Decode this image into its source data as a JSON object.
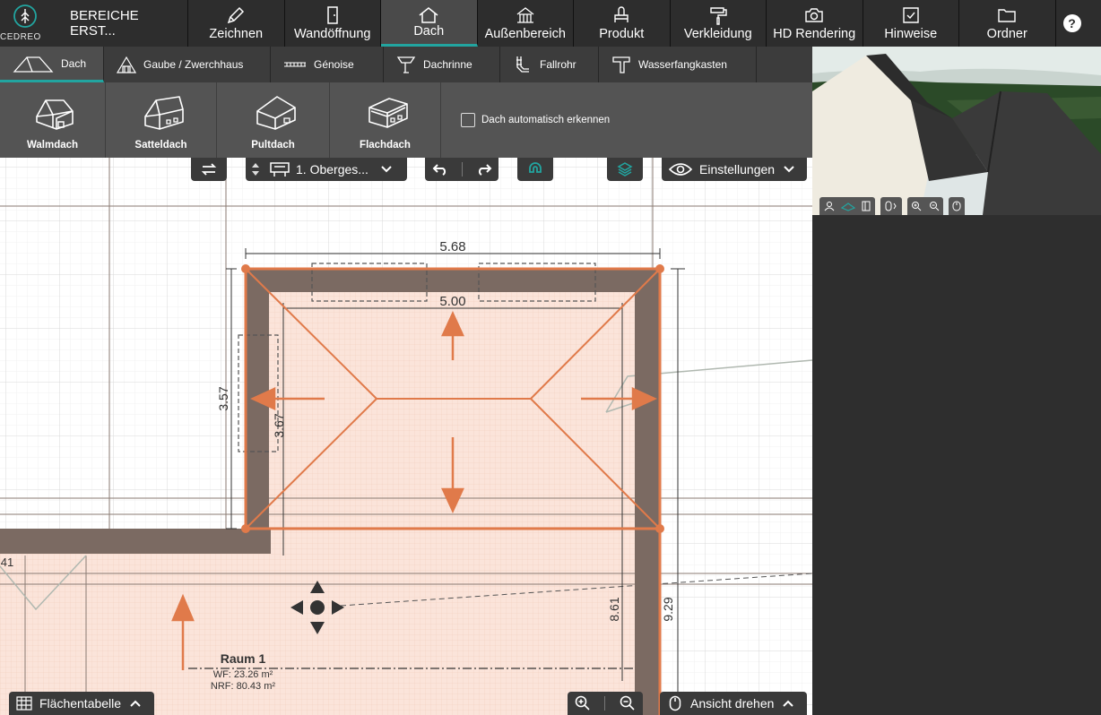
{
  "app": {
    "logo_text": "CEDREO",
    "project_title": "BEREICHE ERST..."
  },
  "main_tabs": [
    {
      "label": "Zeichnen",
      "icon": "pencil-icon"
    },
    {
      "label": "Wandöffnung",
      "icon": "door-icon"
    },
    {
      "label": "Dach",
      "icon": "roof-icon",
      "active": true
    },
    {
      "label": "Außenbereich",
      "icon": "outdoor-icon"
    },
    {
      "label": "Produkt",
      "icon": "product-icon"
    },
    {
      "label": "Verkleidung",
      "icon": "paint-roller-icon"
    },
    {
      "label": "HD Rendering",
      "icon": "camera-icon"
    },
    {
      "label": "Hinweise",
      "icon": "notes-icon"
    },
    {
      "label": "Ordner",
      "icon": "folder-icon"
    }
  ],
  "help_label": "?",
  "sub_tabs": [
    {
      "label": "Dach",
      "active": true
    },
    {
      "label": "Gaube / Zwerchhaus"
    },
    {
      "label": "Génoise"
    },
    {
      "label": "Dachrinne"
    },
    {
      "label": "Fallrohr"
    },
    {
      "label": "Wasserfangkasten"
    }
  ],
  "roof_types": [
    {
      "label": "Walmdach"
    },
    {
      "label": "Satteldach"
    },
    {
      "label": "Pultdach"
    },
    {
      "label": "Flachdach"
    }
  ],
  "auto_detect_label": "Dach automatisch erkennen",
  "canvas_toolbar": {
    "floor_label": "1. Oberges...",
    "settings_label": "Einstellungen"
  },
  "plan": {
    "dim_top_outer": "5.68",
    "dim_top_inner": "5.00",
    "dim_left_outer": "3.57",
    "dim_left_inner": "3.67",
    "dim_right_inner": "8.61",
    "dim_right_outer": "9.29",
    "dim_left_partial": "41",
    "room_name": "Raum 1",
    "room_wf": "WF: 23.26 m²",
    "room_nrf": "NRF: 80.43 m²"
  },
  "bottom_bar": {
    "area_table_label": "Flächentabelle",
    "rotate_view_label": "Ansicht drehen"
  },
  "colors": {
    "accent": "#22a5a0",
    "roof_orange": "#e07a4a",
    "wall_brown": "#7b6a62"
  }
}
